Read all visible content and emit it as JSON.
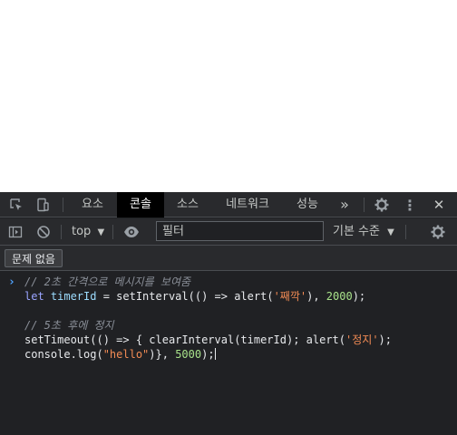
{
  "devtools": {
    "tabs": [
      {
        "label": "요소",
        "active": false
      },
      {
        "label": "콘솔",
        "active": true
      },
      {
        "label": "소스",
        "active": false
      },
      {
        "label": "네트워크",
        "active": false
      },
      {
        "label": "성능",
        "active": false
      }
    ],
    "more_tabs_glyph": "»",
    "settings_icon": "gear-icon",
    "menu_glyph": "⋮",
    "close_glyph": "✕"
  },
  "toolbar": {
    "context_label": "top",
    "filter_placeholder": "필터",
    "log_level_label": "기본 수준"
  },
  "issues": {
    "label": "문제 없음"
  },
  "console": {
    "prompt_glyph": "›",
    "lines": [
      [
        {
          "t": "// 2초 간격으로 메시지를 보여줌",
          "c": "c-comment"
        }
      ],
      [
        {
          "t": "let ",
          "c": "c-kw"
        },
        {
          "t": "timerId",
          "c": "c-var"
        },
        {
          "t": " = setInterval(() => alert(",
          "c": ""
        },
        {
          "t": "'째깍'",
          "c": "c-str"
        },
        {
          "t": "), ",
          "c": ""
        },
        {
          "t": "2000",
          "c": "c-num"
        },
        {
          "t": ");",
          "c": ""
        }
      ],
      [],
      [
        {
          "t": "// 5초 후에 정지",
          "c": "c-comment"
        }
      ],
      [
        {
          "t": "setTimeout(() => { clearInterval(timerId); alert(",
          "c": ""
        },
        {
          "t": "'정지'",
          "c": "c-str"
        },
        {
          "t": ");",
          "c": ""
        }
      ],
      [
        {
          "t": "console.log(",
          "c": ""
        },
        {
          "t": "\"hello\"",
          "c": "c-str"
        },
        {
          "t": ")}, ",
          "c": ""
        },
        {
          "t": "5000",
          "c": "c-num"
        },
        {
          "t": ");",
          "c": ""
        }
      ]
    ]
  }
}
